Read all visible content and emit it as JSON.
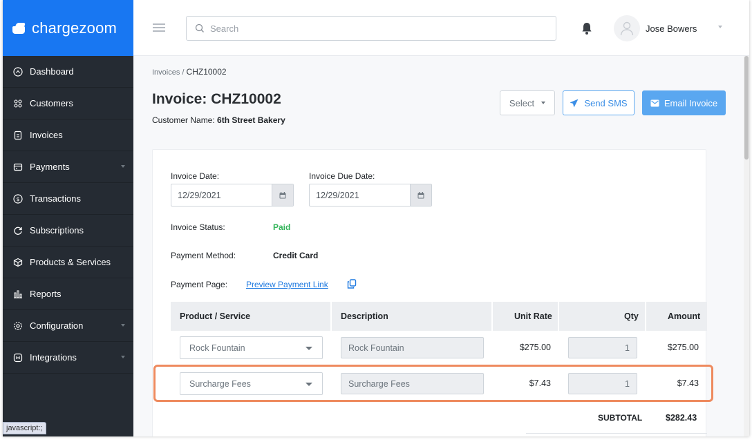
{
  "brand": {
    "name": "chargezoom"
  },
  "sidebar": {
    "items": [
      {
        "label": "Dashboard",
        "icon": "home-icon",
        "has_children": false
      },
      {
        "label": "Customers",
        "icon": "users-icon",
        "has_children": false
      },
      {
        "label": "Invoices",
        "icon": "invoice-icon",
        "has_children": false
      },
      {
        "label": "Payments",
        "icon": "wallet-icon",
        "has_children": true
      },
      {
        "label": "Transactions",
        "icon": "dollar-circle-icon",
        "has_children": false
      },
      {
        "label": "Subscriptions",
        "icon": "refresh-icon",
        "has_children": false
      },
      {
        "label": "Products & Services",
        "icon": "box-icon",
        "has_children": false
      },
      {
        "label": "Reports",
        "icon": "bar-chart-icon",
        "has_children": false
      },
      {
        "label": "Configuration",
        "icon": "gear-icon",
        "has_children": true
      },
      {
        "label": "Integrations",
        "icon": "plug-icon",
        "has_children": true
      }
    ]
  },
  "status_bar": {
    "text": "javascript:;"
  },
  "header": {
    "search_placeholder": "Search",
    "user_name": "Jose Bowers"
  },
  "breadcrumb": {
    "parent": "Invoices",
    "separator": " / ",
    "current": "CHZ10002"
  },
  "page": {
    "title": "Invoice: CHZ10002",
    "customer_label": "Customer Name: ",
    "customer_name": "6th Street Bakery"
  },
  "actions": {
    "select_label": "Select",
    "sms_label": "Send SMS",
    "email_label": "Email Invoice"
  },
  "invoice": {
    "date_label": "Invoice Date:",
    "date_value": "12/29/2021",
    "due_label": "Invoice Due Date:",
    "due_value": "12/29/2021",
    "status_label": "Invoice Status:",
    "status_value": "Paid",
    "method_label": "Payment Method:",
    "method_value": "Credit Card",
    "page_label": "Payment Page:",
    "page_link": "Preview Payment Link"
  },
  "table": {
    "headers": {
      "product": "Product / Service",
      "description": "Description",
      "rate": "Unit Rate",
      "qty": "Qty",
      "amount": "Amount"
    },
    "rows": [
      {
        "product": "Rock Fountain",
        "description": "Rock Fountain",
        "rate": "$275.00",
        "qty": "1",
        "amount": "$275.00"
      },
      {
        "product": "Surcharge Fees",
        "description": "Surcharge Fees",
        "rate": "$7.43",
        "qty": "1",
        "amount": "$7.43"
      }
    ],
    "subtotal_label": "SUBTOTAL",
    "subtotal_value": "$282.43"
  },
  "colors": {
    "brand_blue": "#1877f2",
    "sidebar_bg": "#252b33",
    "paid_green": "#34b45a",
    "highlight_orange": "#ee8a5e",
    "email_button": "#5aa7f0"
  }
}
